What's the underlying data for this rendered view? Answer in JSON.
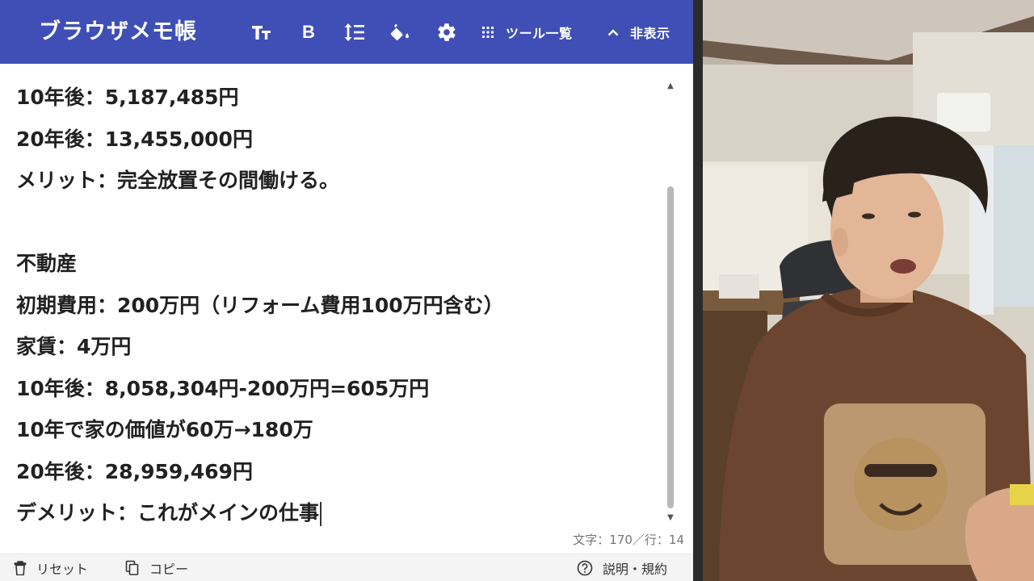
{
  "app": {
    "title": "ブラウザメモ帳",
    "toolbar": {
      "text_size_icon": "text-size-icon",
      "bold_label": "B",
      "line_spacing_icon": "line-spacing-icon",
      "fill_icon": "paint-bucket-icon",
      "settings_icon": "gear-icon",
      "list_label": "ツール一覧",
      "hide_label": "非表示"
    },
    "colors": {
      "header": "#3f4fb5",
      "text": "#212121"
    }
  },
  "editor": {
    "lines": [
      "10年後：5,187,485円",
      "20年後：13,455,000円",
      "メリット：完全放置その間働ける。",
      "",
      "不動産",
      "初期費用：200万円（リフォーム費用100万円含む）",
      "家賃：4万円",
      "10年後：8,058,304円-200万円=605万円",
      "10年で家の価値が60万→180万",
      "20年後：28,959,469円",
      "デメリット：これがメインの仕事"
    ]
  },
  "status": {
    "counter": "文字：170／行：14"
  },
  "footer": {
    "reset_label": "リセット",
    "copy_label": "コピー",
    "help_label": "説明・規約"
  }
}
